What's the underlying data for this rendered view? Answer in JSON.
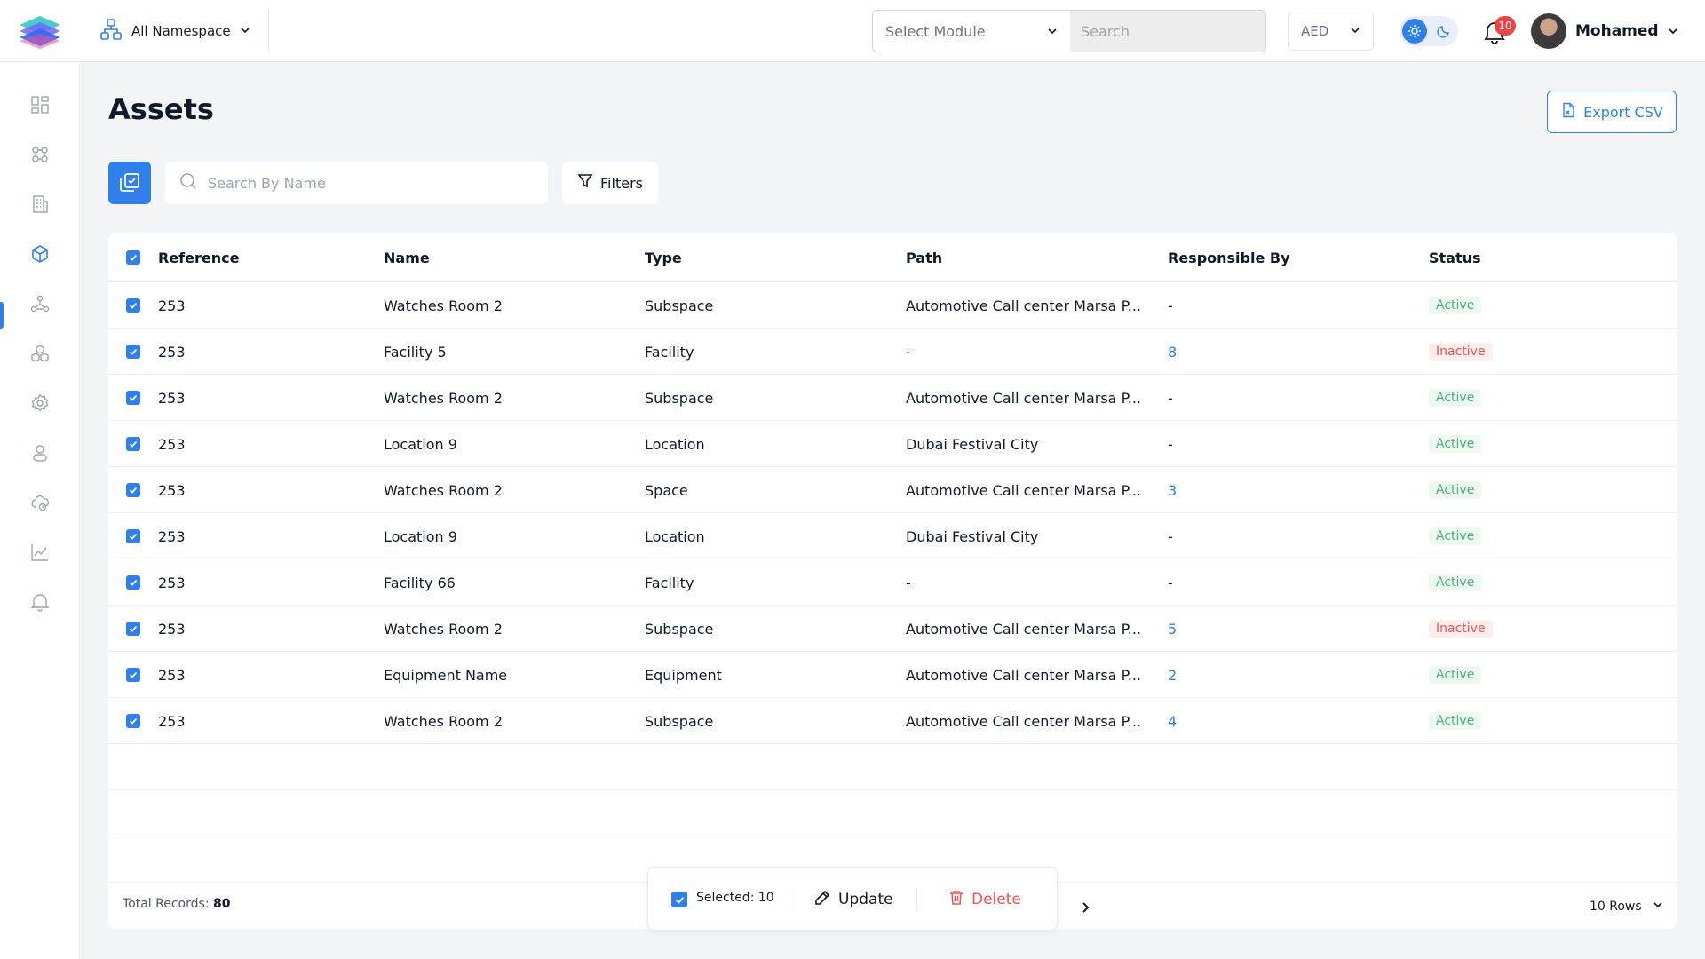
{
  "header": {
    "namespace_label": "All Namespace",
    "module_placeholder": "Select Module",
    "search_placeholder": "Search",
    "currency": "AED",
    "notification_count": "10",
    "user_name": "Mohamed"
  },
  "sidebar": {
    "items": [
      {
        "icon": "dashboard-icon"
      },
      {
        "icon": "modules-icon"
      },
      {
        "icon": "building-icon"
      },
      {
        "icon": "asset-cube-icon"
      },
      {
        "icon": "network-icon"
      },
      {
        "icon": "cubes-icon"
      },
      {
        "icon": "gear-icon"
      },
      {
        "icon": "user-icon"
      },
      {
        "icon": "cloud-icon"
      },
      {
        "icon": "chart-icon"
      },
      {
        "icon": "bell-icon"
      }
    ],
    "active_index": 3
  },
  "page": {
    "title": "Assets",
    "export_label": "Export CSV",
    "search_placeholder": "Search By Name",
    "filters_label": "Filters"
  },
  "table": {
    "columns": [
      "Reference",
      "Name",
      "Type",
      "Path",
      "Responsible By",
      "Status"
    ],
    "rows": [
      {
        "ref": "253",
        "name": "Watches Room 2",
        "type": "Subspace",
        "path": "Automotive Call center Marsa P...",
        "responsible": "-",
        "status": "Active"
      },
      {
        "ref": "253",
        "name": "Facility 5",
        "type": "Facility",
        "path": "-",
        "responsible": "8",
        "status": "Inactive"
      },
      {
        "ref": "253",
        "name": "Watches Room 2",
        "type": "Subspace",
        "path": "Automotive Call center Marsa P...",
        "responsible": "-",
        "status": "Active"
      },
      {
        "ref": "253",
        "name": "Location 9",
        "type": "Location",
        "path": "Dubai Festival City",
        "responsible": "-",
        "status": "Active"
      },
      {
        "ref": "253",
        "name": "Watches Room 2",
        "type": "Space",
        "path": "Automotive Call center Marsa P...",
        "responsible": "3",
        "status": "Active"
      },
      {
        "ref": "253",
        "name": "Location 9",
        "type": "Location",
        "path": "Dubai Festival City",
        "responsible": "-",
        "status": "Active"
      },
      {
        "ref": "253",
        "name": "Facility 66",
        "type": "Facility",
        "path": "-",
        "responsible": "-",
        "status": "Active"
      },
      {
        "ref": "253",
        "name": "Watches Room 2",
        "type": "Subspace",
        "path": "Automotive Call center Marsa P...",
        "responsible": "5",
        "status": "Inactive"
      },
      {
        "ref": "253",
        "name": "Equipment Name",
        "type": "Equipment",
        "path": "Automotive Call center Marsa P...",
        "responsible": "2",
        "status": "Active"
      },
      {
        "ref": "253",
        "name": "Watches Room 2",
        "type": "Subspace",
        "path": "Automotive Call center Marsa P...",
        "responsible": "4",
        "status": "Active"
      }
    ]
  },
  "footer": {
    "total_label": "Total Records:",
    "total_value": "80",
    "selected_label": "Selected: 10",
    "update_label": "Update",
    "delete_label": "Delete",
    "rows_label": "10 Rows"
  },
  "colors": {
    "accent": "#2f80ed",
    "active_text": "#4caf7d",
    "inactive_text": "#ef5350"
  }
}
